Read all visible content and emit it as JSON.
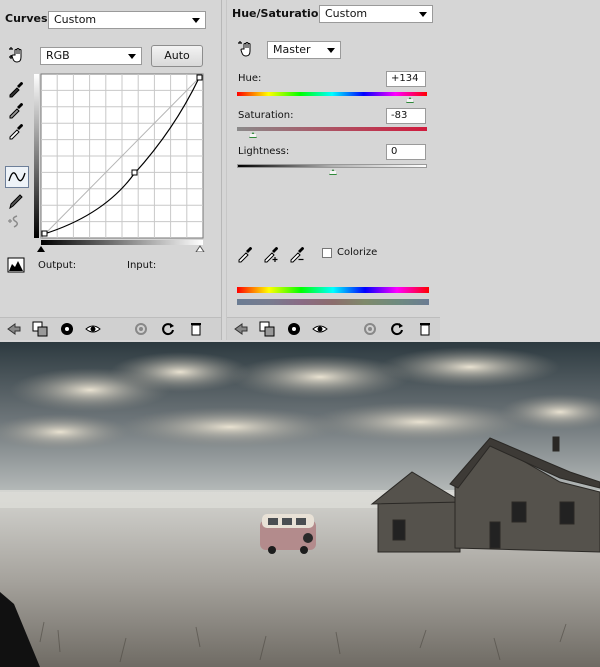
{
  "curves": {
    "title": "Curves",
    "preset": "Custom",
    "channel": "RGB",
    "auto_label": "Auto",
    "output_label": "Output:",
    "input_label": "Input:"
  },
  "hue_saturation": {
    "title": "Hue/Saturation",
    "preset": "Custom",
    "range": "Master",
    "hue_label": "Hue:",
    "hue_value": "+134",
    "saturation_label": "Saturation:",
    "saturation_value": "-83",
    "lightness_label": "Lightness:",
    "lightness_value": "0",
    "colorize_label": "Colorize",
    "colorize_checked": false
  },
  "icons": [
    "curves-hand-icon",
    "eyedropper-black-icon",
    "eyedropper-gray-icon",
    "eyedropper-white-icon",
    "curve-tool-icon",
    "pencil-icon",
    "smooth-icon",
    "histogram-warning-icon",
    "back-arrow-icon",
    "clip-layer-icon",
    "visibility-eye-icon",
    "eye-icon",
    "previous-state-icon",
    "reset-icon",
    "trash-icon"
  ]
}
